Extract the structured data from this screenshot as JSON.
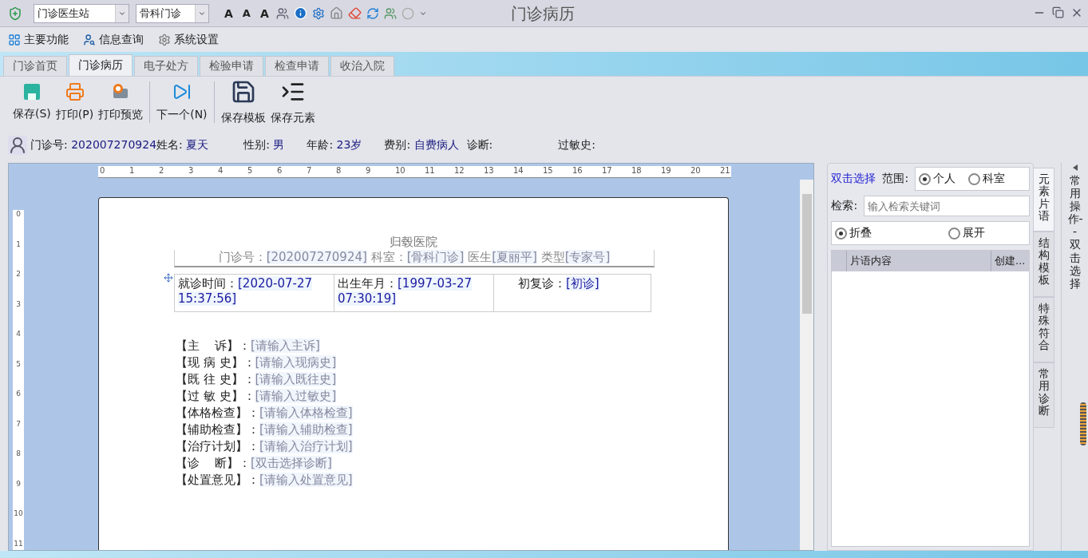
{
  "title_bar": {
    "station": "门诊医生站",
    "department": "骨科门诊",
    "font_buttons": [
      "A",
      "A",
      "A"
    ],
    "title": "门诊病历"
  },
  "menu": [
    {
      "label": "主要功能",
      "kind": "grid"
    },
    {
      "label": "信息查询",
      "kind": "search"
    },
    {
      "label": "系统设置",
      "kind": "gear"
    }
  ],
  "tabs": [
    {
      "label": "门诊首页",
      "selected": false
    },
    {
      "label": "门诊病历",
      "selected": true
    },
    {
      "label": "电子处方",
      "selected": false
    },
    {
      "label": "检验申请",
      "selected": false
    },
    {
      "label": "检查申请",
      "selected": false
    },
    {
      "label": "收治入院",
      "selected": false
    }
  ],
  "toolbar": [
    [
      {
        "label": "保存(S)",
        "kind": "save"
      },
      {
        "label": "打印(P)",
        "kind": "print"
      },
      {
        "label": "打印预览",
        "kind": "preview"
      }
    ],
    [
      {
        "label": "下一个(N)",
        "kind": "next"
      }
    ],
    [
      {
        "label": "保存模板",
        "kind": "floppy"
      },
      {
        "label": "保存元素",
        "kind": "element"
      }
    ]
  ],
  "patient": [
    {
      "label": "门诊号:",
      "value": "202007270924"
    },
    {
      "label": "姓名:",
      "value": "夏天"
    },
    {
      "label": "性别:",
      "value": "男"
    },
    {
      "label": "年龄:",
      "value": "23岁"
    },
    {
      "label": "费别:",
      "value": "自费病人"
    },
    {
      "label": "诊断:"
    },
    {
      "label": "过敏史:"
    }
  ],
  "ruler": {
    "horizontal": [
      "0",
      "1",
      "2",
      "3",
      "4",
      "5",
      "6",
      "7",
      "8",
      "9",
      "10",
      "11",
      "12",
      "13",
      "14",
      "15",
      "16",
      "17",
      "18",
      "19",
      "20",
      "21"
    ],
    "vertical": [
      "0",
      "1",
      "2",
      "3",
      "4",
      "5",
      "6",
      "7",
      "8",
      "9",
      "10",
      "11"
    ]
  },
  "document": {
    "hospital": "归毂医院",
    "header": [
      {
        "label": "门诊号：",
        "value": "[202007270924]"
      },
      {
        "label": "科室：",
        "value": "[骨科门诊]"
      },
      {
        "label": "医生",
        "value": "[夏丽平]"
      },
      {
        "label": "类型",
        "value": "[专家号]"
      }
    ],
    "info_cells": [
      {
        "label": "就诊时间：",
        "value": "[2020-07-27 15:37:56]"
      },
      {
        "label": "出生年月：",
        "value": "[1997-03-27 07:30:19]"
      },
      {
        "label": "初复诊：",
        "value": "[初诊]"
      }
    ],
    "sections": [
      {
        "label": "【主    诉】：",
        "value": "[请输入主诉]"
      },
      {
        "label": "【现 病 史】：",
        "value": "[请输入现病史]"
      },
      {
        "label": "【既 往 史】：",
        "value": "[请输入既往史]"
      },
      {
        "label": "【过 敏 史】：",
        "value": "[请输入过敏史]"
      },
      {
        "label": "【体格检查】：",
        "value": "[请输入体格检查]"
      },
      {
        "label": "【辅助检查】：",
        "value": "[请输入辅助检查]"
      },
      {
        "label": "【治疗计划】：",
        "value": "[请输入治疗计划]"
      },
      {
        "label": "【诊    断】：",
        "value": "[双击选择诊断]"
      },
      {
        "label": "【处置意见】：",
        "value": "[请输入处置意见]"
      }
    ]
  },
  "right_panel": {
    "link": "双击选择",
    "scope_label": "范围:",
    "scope": [
      {
        "label": "个人",
        "selected": true
      },
      {
        "label": "科室",
        "selected": false
      }
    ],
    "search_label": "检索:",
    "search_placeholder": "输入检索关键词",
    "view": [
      {
        "label": "折叠",
        "selected": true
      },
      {
        "label": "展开",
        "selected": false
      }
    ],
    "columns": [
      "片语内容",
      "创建..."
    ],
    "side_tabs": [
      {
        "label": "元素片语",
        "selected": true
      },
      {
        "label": "结构模板",
        "selected": false
      },
      {
        "label": "特殊符合",
        "selected": false
      },
      {
        "label": "常用诊断",
        "selected": false
      }
    ]
  },
  "side_strip": {
    "label": "常用操作--双击选择"
  }
}
